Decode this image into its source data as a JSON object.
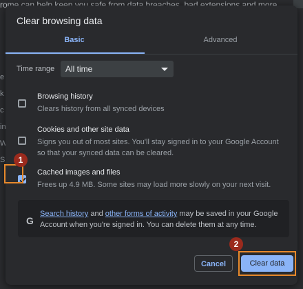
{
  "background": {
    "top_text": "rome can help keep you safe from data breaches, bad extensions and more",
    "left_glyphs": [
      "e",
      "k",
      "c",
      "in",
      "W",
      "S"
    ]
  },
  "dialog": {
    "title": "Clear browsing data",
    "tabs": [
      {
        "label": "Basic",
        "active": true
      },
      {
        "label": "Advanced",
        "active": false
      }
    ],
    "time_range": {
      "label": "Time range",
      "value": "All time"
    },
    "items": [
      {
        "title": "Browsing history",
        "description": "Clears history from all synced devices",
        "checked": false
      },
      {
        "title": "Cookies and other site data",
        "description": "Signs you out of most sites. You'll stay signed in to your Google Account so that your synced data can be cleared.",
        "checked": false
      },
      {
        "title": "Cached images and files",
        "description": "Frees up 4.9 MB. Some sites may load more slowly on your next visit.",
        "checked": true
      }
    ],
    "info": {
      "icon": "G",
      "link1": "Search history",
      "middle": " and ",
      "link2": "other forms of activity",
      "rest": " may be saved in your Google Account when you're signed in. You can delete them at any time."
    },
    "buttons": {
      "cancel": "Cancel",
      "clear": "Clear data"
    }
  },
  "annotations": {
    "badge1": "1",
    "badge2": "2"
  },
  "colors": {
    "accent": "#8ab4f8",
    "highlight": "#e8892b",
    "badge": "#9b2a1d"
  }
}
